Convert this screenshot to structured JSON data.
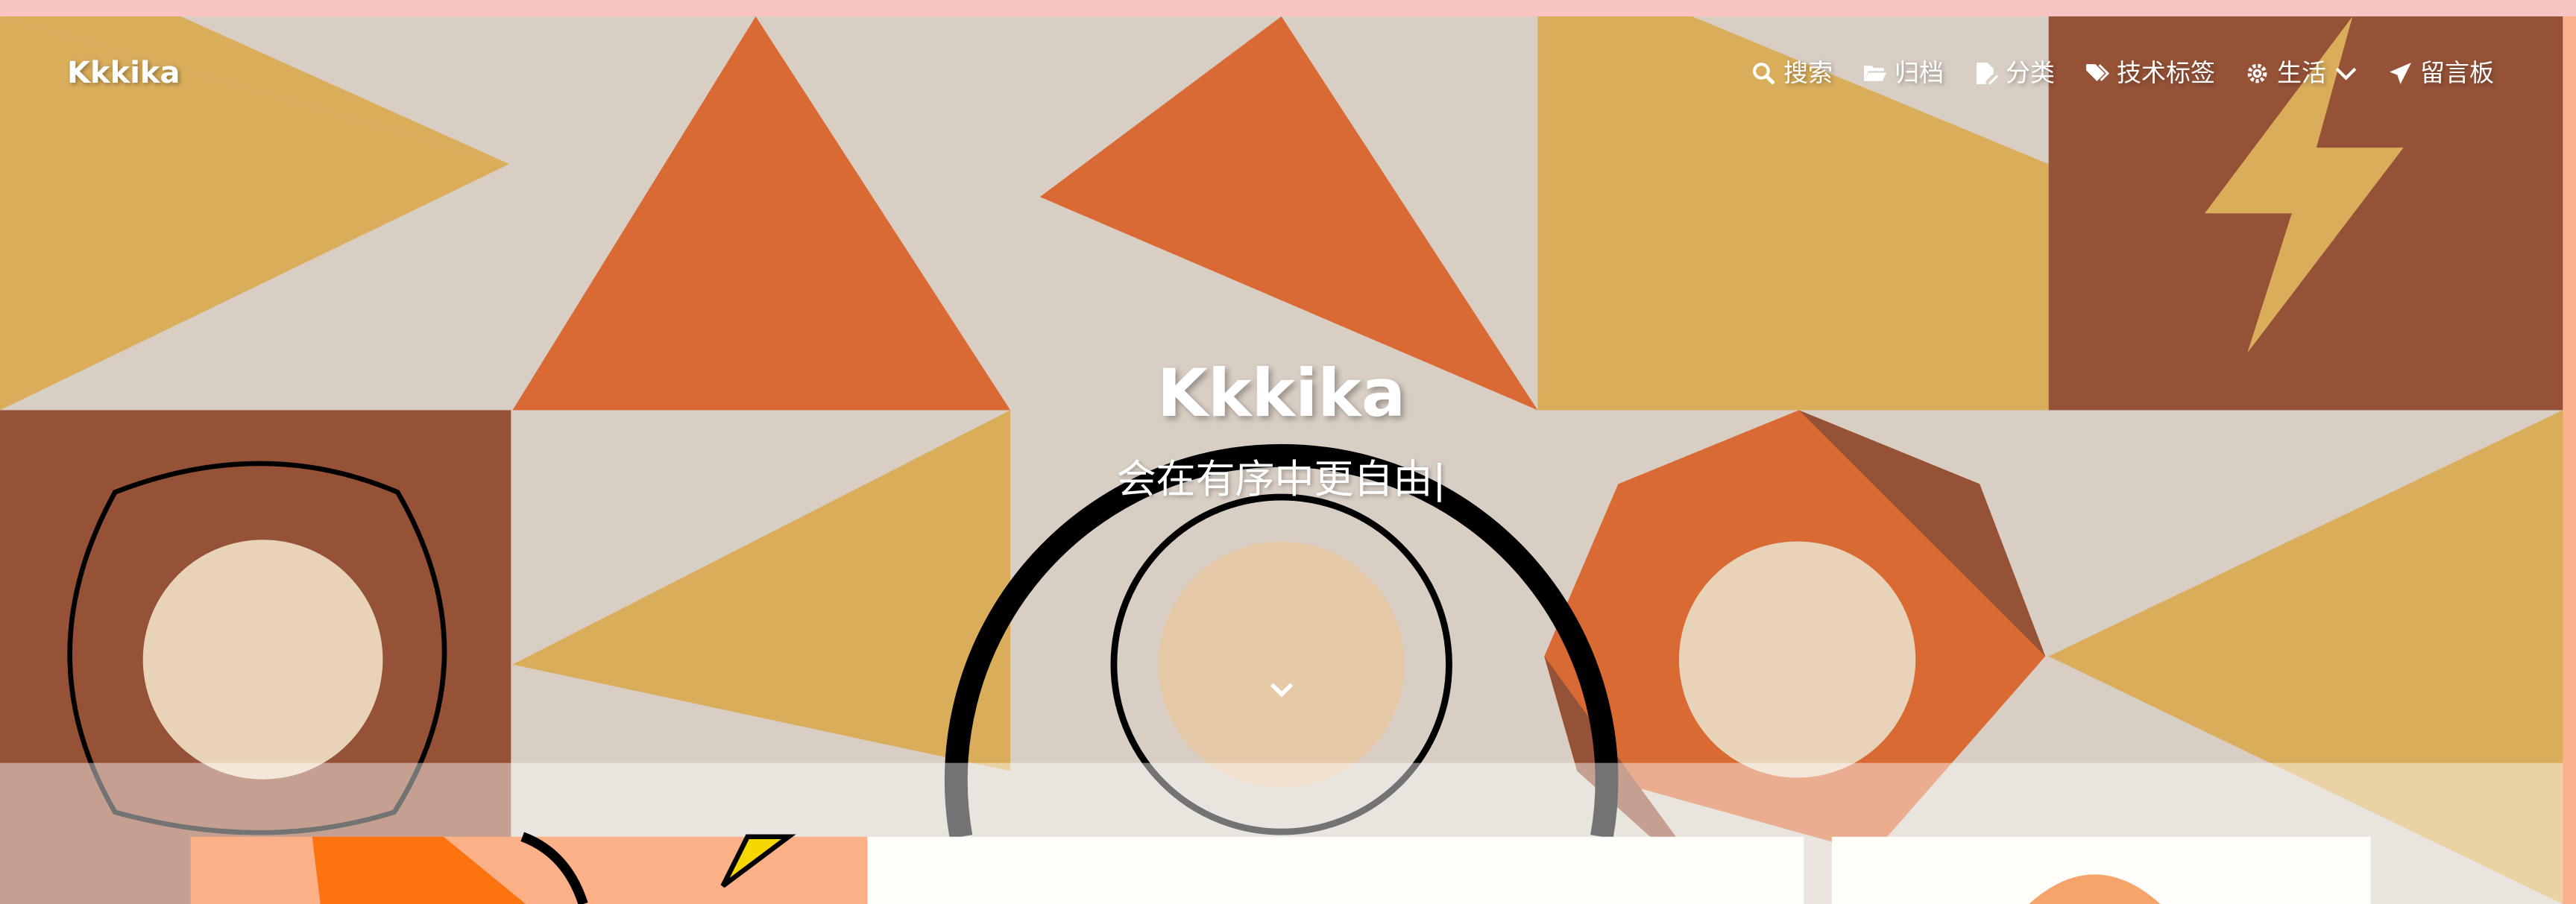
{
  "header": {
    "brand": "Kkkika",
    "nav": [
      {
        "label": "搜索",
        "icon": "search-icon"
      },
      {
        "label": "归档",
        "icon": "folder-open-icon"
      },
      {
        "label": "分类",
        "icon": "file-edit-icon"
      },
      {
        "label": "技术标签",
        "icon": "tags-icon"
      },
      {
        "label": "生活",
        "icon": "gear-icon",
        "dropdown": true
      },
      {
        "label": "留言板",
        "icon": "paper-plane-icon"
      }
    ]
  },
  "hero": {
    "title": "Kkkika",
    "subtitle": "会在有序中更自由|"
  },
  "colors": {
    "orange": "#d96a33",
    "mustard": "#d9ad5a",
    "brown": "#955237",
    "beige": "#d9cec4",
    "top_bar": "#f7c3c3"
  }
}
